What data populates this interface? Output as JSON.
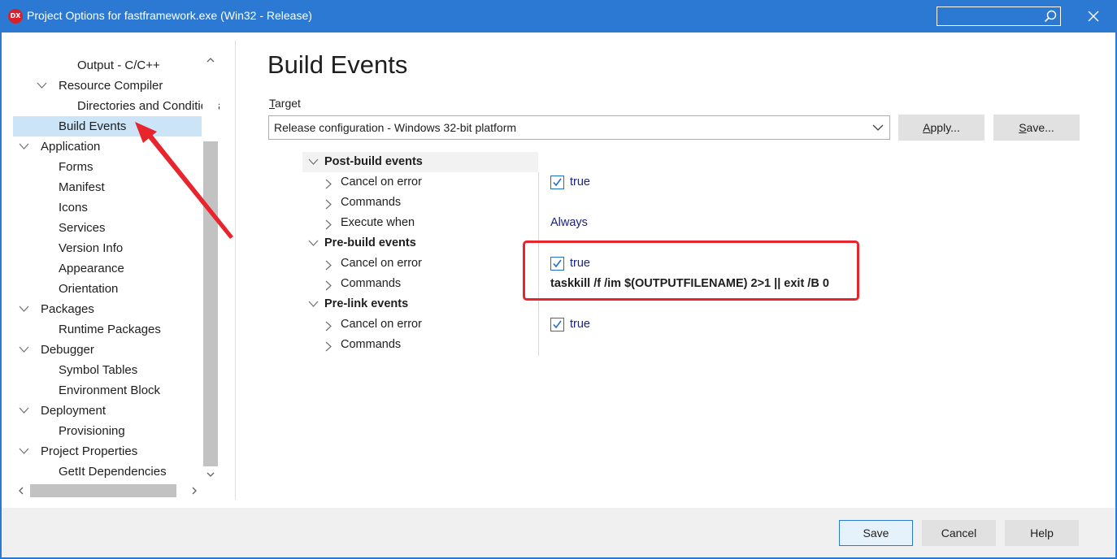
{
  "window": {
    "title": "Project Options for fastframework.exe  (Win32 - Release)",
    "logo_text": "DX"
  },
  "tree": {
    "items": [
      {
        "label": "Output - C/C++",
        "indent": 2,
        "expander": "none"
      },
      {
        "label": "Resource Compiler",
        "indent": 1,
        "expander": "expanded"
      },
      {
        "label": "Directories and Conditions",
        "indent": 2,
        "expander": "none"
      },
      {
        "label": "Build Events",
        "indent": 1,
        "expander": "none",
        "selected": true
      },
      {
        "label": "Application",
        "indent": 0,
        "expander": "expanded"
      },
      {
        "label": "Forms",
        "indent": 1,
        "expander": "none"
      },
      {
        "label": "Manifest",
        "indent": 1,
        "expander": "none"
      },
      {
        "label": "Icons",
        "indent": 1,
        "expander": "none"
      },
      {
        "label": "Services",
        "indent": 1,
        "expander": "none"
      },
      {
        "label": "Version Info",
        "indent": 1,
        "expander": "none"
      },
      {
        "label": "Appearance",
        "indent": 1,
        "expander": "none"
      },
      {
        "label": "Orientation",
        "indent": 1,
        "expander": "none"
      },
      {
        "label": "Packages",
        "indent": 0,
        "expander": "expanded"
      },
      {
        "label": "Runtime Packages",
        "indent": 1,
        "expander": "none"
      },
      {
        "label": "Debugger",
        "indent": 0,
        "expander": "expanded"
      },
      {
        "label": "Symbol Tables",
        "indent": 1,
        "expander": "none"
      },
      {
        "label": "Environment Block",
        "indent": 1,
        "expander": "none"
      },
      {
        "label": "Deployment",
        "indent": 0,
        "expander": "expanded"
      },
      {
        "label": "Provisioning",
        "indent": 1,
        "expander": "none"
      },
      {
        "label": "Project Properties",
        "indent": 0,
        "expander": "expanded"
      },
      {
        "label": "GetIt Dependencies",
        "indent": 1,
        "expander": "none"
      }
    ]
  },
  "main": {
    "title": "Build Events",
    "target_label_first": "T",
    "target_label_rest": "arget",
    "target_value": "Release configuration - Windows 32-bit platform",
    "apply_first": "A",
    "apply_rest": "pply...",
    "save_first": "S",
    "save_rest": "ave..."
  },
  "grid": {
    "post_build": {
      "label": "Post-build events",
      "cancel_on_error": "Cancel on error",
      "cancel_value": "true",
      "commands": "Commands",
      "execute_when": "Execute when",
      "execute_value": "Always"
    },
    "pre_build": {
      "label": "Pre-build events",
      "cancel_on_error": "Cancel on error",
      "cancel_value": "true",
      "commands": "Commands",
      "commands_value": "taskkill /f /im $(OUTPUTFILENAME)  2>1 || exit /B 0"
    },
    "pre_link": {
      "label": "Pre-link events",
      "cancel_on_error": "Cancel on error",
      "cancel_value": "true",
      "commands": "Commands"
    }
  },
  "footer": {
    "save": "Save",
    "cancel": "Cancel",
    "help": "Help"
  },
  "colors": {
    "title_bar": "#2b79d2",
    "selection": "#cce4f7",
    "annotation": "#e8242c",
    "value_text": "#1a237e"
  }
}
